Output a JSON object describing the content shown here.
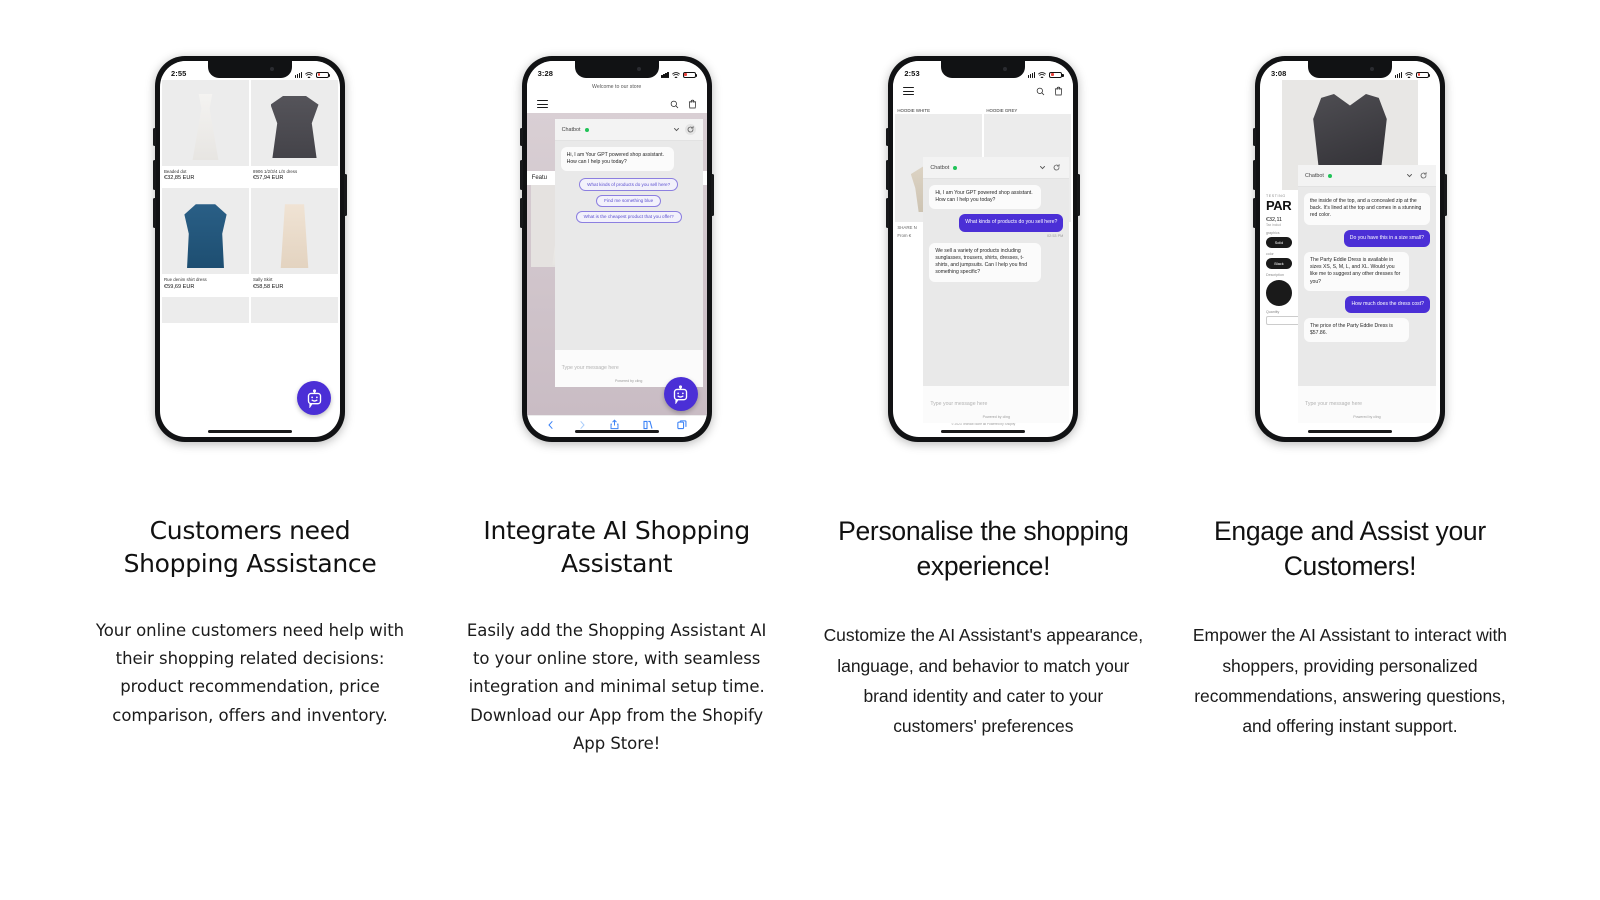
{
  "accent": {
    "purple": "#4B2FD6",
    "chip_border": "#8C7FE0",
    "online_green": "#20C358",
    "battery_red": "#E8413A"
  },
  "columns": [
    {
      "id": "customers-need-assistance",
      "headline": "Customers need Shopping Assistance",
      "body": "Your online customers need help with their shopping related decisions: product recommendation, price comparison, offers and inventory.",
      "phone": {
        "status": {
          "time": "2:55",
          "signal": "cellular-bars",
          "wifi": "wifi-icon",
          "battery": "battery-low"
        },
        "screen": "product-grid",
        "products": [
          {
            "name": "Beaded dot",
            "price": "€32,85 EUR"
          },
          {
            "name": "8906 1/2/3/4 L/S dress",
            "price": "€57,94 EUR"
          },
          {
            "name": "Rue denim shirt dress",
            "price": "€59,69 EUR"
          },
          {
            "name": "Sally Skirt",
            "price": "€58,58 EUR"
          }
        ],
        "fab": "chatbot-robot-icon"
      }
    },
    {
      "id": "integrate-ai-assistant",
      "headline": "Integrate AI Shopping Assistant",
      "body": "Easily add the Shopping Assistant AI to your online store, with seamless integration and minimal setup time. Download our App from the Shopify App Store!",
      "phone": {
        "status": {
          "time": "3:28",
          "signal": "cellular-bars",
          "wifi": "wifi-icon",
          "battery": "battery-low"
        },
        "screen": "store-home-with-chat",
        "announcement": "Welcome to our store",
        "section_label": "Featu",
        "chat": {
          "title": "Chatbot",
          "status": "online",
          "messages": [
            {
              "from": "bot",
              "text": "Hi, I am Your GPT powered shop assistant. How can I help you today?"
            }
          ],
          "suggestions": [
            "What kinds of products do you sell here?",
            "Find me something blue",
            "What is the cheapest product that you offer?"
          ],
          "input_placeholder": "Type your message here",
          "powered_by": "Powered by cling"
        },
        "fab": "chatbot-robot-icon",
        "browser_bar": [
          "back-icon",
          "forward-icon",
          "share-icon",
          "bookmarks-icon",
          "tabs-icon"
        ]
      }
    },
    {
      "id": "personalise-shopping",
      "headline": "Personalise the shopping experience!",
      "body": "Customize the AI Assistant's appearance, language, and behavior to match your brand identity and cater to your customers' preferences",
      "phone": {
        "status": {
          "time": "2:53",
          "signal": "cellular-bars",
          "wifi": "wifi-icon",
          "battery": "battery-low"
        },
        "screen": "product-grid-with-chat",
        "products": [
          {
            "name": "HOODIE WHITE",
            "price": ""
          },
          {
            "name": "HOODIE GREY",
            "price": ""
          }
        ],
        "page_text": {
          "share": "SHARE N",
          "from": "From €"
        },
        "chat": {
          "title": "Chatbot",
          "status": "online",
          "messages": [
            {
              "from": "bot",
              "text": "Hi, I am Your GPT powered shop assistant. How can I help you today?"
            },
            {
              "from": "user",
              "text": "What kinds of products do you sell here?",
              "time": "02:53 PM"
            },
            {
              "from": "bot",
              "text": "We sell a variety of products including sunglasses, trousers, shirts, dresses, t-shirts, and jumpsuits. Can I help you find something specific?"
            }
          ],
          "input_placeholder": "Type your message here",
          "powered_by": "Powered by cling"
        },
        "footer": "© 2023 Techlab Store all Powered by Shopify"
      }
    },
    {
      "id": "engage-and-assist",
      "headline": "Engage and Assist your Customers!",
      "body": "Empower the AI Assistant to interact with shoppers, providing personalized recommendations, answering questions, and offering instant support.",
      "phone": {
        "status": {
          "time": "3:08",
          "signal": "cellular-bars",
          "wifi": "wifi-icon",
          "battery": "battery-low"
        },
        "screen": "product-detail-with-chat",
        "pdp": {
          "eyebrow": "TESTING",
          "title": "PAR",
          "price": "€32,11",
          "tax_note": "Tax includ",
          "graphics_label": "graphics",
          "graphics_value": "Solid",
          "color_label": "color",
          "color_value": "Black",
          "description_label": "Description",
          "quantity_label": "Quantity"
        },
        "chat": {
          "title": "Chatbot",
          "status": "online",
          "messages": [
            {
              "from": "bot",
              "text": "the inside of the top, and a concealed zip at the back. It's lined at the top and comes in a stunning red color."
            },
            {
              "from": "user",
              "text": "Do you have this in a size small?"
            },
            {
              "from": "bot",
              "text": "The Party Eddie Dress is available in sizes XS, S, M, L, and XL. Would you like me to suggest any other dresses for you?"
            },
            {
              "from": "user",
              "text": "How much does the dress cost?"
            },
            {
              "from": "bot",
              "text": "The price of the Party Eddie Dress is $57.86."
            }
          ],
          "input_placeholder": "Type your message here",
          "powered_by": "Powered by cling"
        }
      }
    }
  ]
}
